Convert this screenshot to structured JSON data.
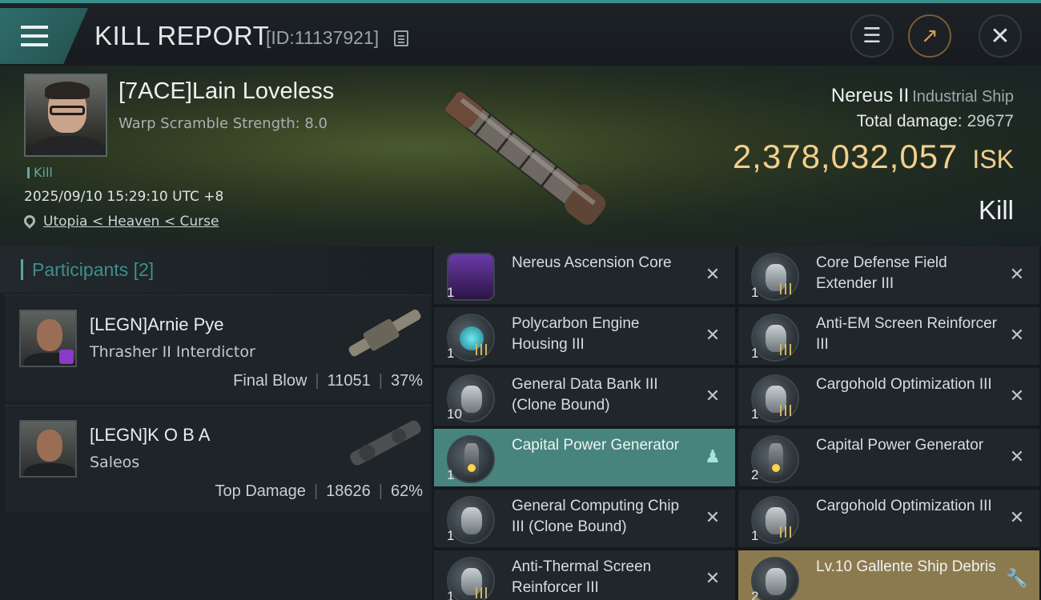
{
  "header": {
    "title": "KILL REPORT",
    "report_id": "[ID:11137921]"
  },
  "victim": {
    "name": "[7ACE]Lain Loveless",
    "warp_scramble": "Warp Scramble Strength: 8.0",
    "tag": "Kill",
    "datetime": "2025/09/10 15:29:10 UTC +8",
    "location": "Utopia < Heaven < Curse",
    "ship": "Nereus II",
    "ship_class": "Industrial Ship",
    "total_damage_label": "Total damage:",
    "total_damage": "29677",
    "isk_value": "2,378,032,057",
    "isk_label": "ISK",
    "result": "Kill"
  },
  "participants": {
    "label": "Participants",
    "count": "[2]",
    "list": [
      {
        "name": "[LEGN]Arnie Pye",
        "ship": "Thrasher II Interdictor",
        "stat_label": "Final Blow",
        "damage": "11051",
        "percent": "37%"
      },
      {
        "name": "[LEGN]K O B A",
        "ship": "Saleos",
        "stat_label": "Top Damage",
        "damage": "18626",
        "percent": "62%"
      }
    ]
  },
  "items": [
    {
      "name": "Nereus Ascension Core",
      "qty": "1",
      "icon": "ascension-core-icon",
      "state": "destroyed"
    },
    {
      "name": "Core Defense Field Extender III",
      "qty": "1",
      "icon": "shield-module-icon",
      "state": "destroyed"
    },
    {
      "name": "Polycarbon Engine Housing III",
      "qty": "1",
      "icon": "engine-module-icon",
      "state": "destroyed"
    },
    {
      "name": "Anti-EM Screen Reinforcer III",
      "qty": "1",
      "icon": "shield-module-icon",
      "state": "destroyed"
    },
    {
      "name": "General Data Bank III (Clone Bound)",
      "qty": "10",
      "icon": "data-bank-icon",
      "state": "destroyed"
    },
    {
      "name": "Cargohold Optimization III",
      "qty": "1",
      "icon": "cargohold-module-icon",
      "state": "destroyed"
    },
    {
      "name": "Capital Power Generator",
      "qty": "1",
      "icon": "power-generator-icon",
      "state": "dropped"
    },
    {
      "name": "Capital Power Generator",
      "qty": "2",
      "icon": "power-generator-icon",
      "state": "destroyed"
    },
    {
      "name": "General Computing Chip III (Clone Bound)",
      "qty": "1",
      "icon": "computing-chip-icon",
      "state": "destroyed"
    },
    {
      "name": "Cargohold Optimization III",
      "qty": "1",
      "icon": "cargohold-module-icon",
      "state": "destroyed"
    },
    {
      "name": "Anti-Thermal Screen Reinforcer III",
      "qty": "1",
      "icon": "shield-module-icon",
      "state": "destroyed"
    },
    {
      "name": "Lv.10 Gallente Ship Debris",
      "qty": "2",
      "icon": "ship-debris-icon",
      "state": "salvage"
    }
  ],
  "colors": {
    "accent_teal": "#3a8f8b",
    "isk_gold": "#f2cf8a",
    "dropped_highlight": "#47847e",
    "salvage_highlight": "#8c7a4f"
  }
}
